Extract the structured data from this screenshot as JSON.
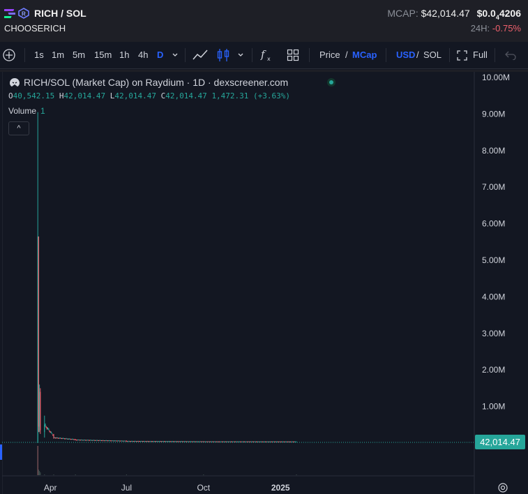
{
  "header": {
    "pair": "RICH / SOL",
    "subtitle": "CHOOSERICH",
    "mcap_label": "MCAP:",
    "mcap_value": "$42,014.47",
    "price": "$0.0",
    "price_subscript": "4",
    "price_digits": "4206",
    "change_label": "24H:",
    "change_value": "-0.75%",
    "colors": {
      "negative": "#f0616d",
      "positive": "#26a69a",
      "accent": "#2962ff"
    }
  },
  "toolbar": {
    "intervals": [
      "1s",
      "1m",
      "5m",
      "15m",
      "1h",
      "4h",
      "D"
    ],
    "active_interval": "D",
    "price_label": "Price",
    "slash": "/",
    "mcap_label": "MCap",
    "usd_label": "USD",
    "sol_label": "SOL",
    "full_label": "Full",
    "icons": [
      "add-icon",
      "chevron-down-icon",
      "line-tool-icon",
      "candles-icon",
      "indicators-icon",
      "layout-icon",
      "fullscreen-icon",
      "undo-icon"
    ]
  },
  "legend": {
    "title": "RICH/SOL (Market Cap) on Raydium · 1D · dexscreener.com",
    "o_label": "O",
    "o": "40,542.15",
    "h_label": "H",
    "h": "42,014.47",
    "l_label": "L",
    "l": "42,014.47",
    "c_label": "C",
    "c": "42,014.47",
    "change": "1,472.31 (+3.63%)",
    "volume_label": "Volume",
    "volume_value": "1",
    "collapse_glyph": "^"
  },
  "last_price_label": "42,014.47",
  "chart_data": {
    "type": "candlestick",
    "title": "RICH/SOL (Market Cap) on Raydium · 1D · dexscreener.com",
    "y_ticks": [
      "1.00M",
      "2.00M",
      "3.00M",
      "4.00M",
      "5.00M",
      "6.00M",
      "7.00M",
      "8.00M",
      "9.00M",
      "10.00M"
    ],
    "ylim": [
      0,
      10000000
    ],
    "x_ticks": [
      "Apr",
      "Jul",
      "Oct",
      "2025"
    ],
    "grid": false,
    "last_value": 42014.47,
    "approx_series": [
      {
        "x": "2024-03-17",
        "o": 0,
        "h": 9050000,
        "l": 0,
        "c": 5650000
      },
      {
        "x": "2024-03-18",
        "o": 5650000,
        "h": 5650000,
        "l": 300000,
        "c": 450000
      },
      {
        "x": "2024-03-19",
        "o": 450000,
        "h": 1600000,
        "l": 300000,
        "c": 1400000
      },
      {
        "x": "2024-03-20",
        "o": 1400000,
        "h": 1500000,
        "l": 250000,
        "c": 350000
      },
      {
        "x": "2024-03-25",
        "o": 300000,
        "h": 750000,
        "l": 150000,
        "c": 500000
      },
      {
        "x": "2024-04-05",
        "o": 200000,
        "h": 250000,
        "l": 120000,
        "c": 150000
      },
      {
        "x": "2024-05-01",
        "o": 100000,
        "h": 110000,
        "l": 80000,
        "c": 90000
      },
      {
        "x": "2024-07-01",
        "o": 60000,
        "h": 70000,
        "l": 50000,
        "c": 55000
      },
      {
        "x": "2024-10-01",
        "o": 45000,
        "h": 50000,
        "l": 40000,
        "c": 44000
      },
      {
        "x": "2025-01-20",
        "o": 40542.15,
        "h": 42014.47,
        "l": 42014.47,
        "c": 42014.47
      }
    ]
  }
}
